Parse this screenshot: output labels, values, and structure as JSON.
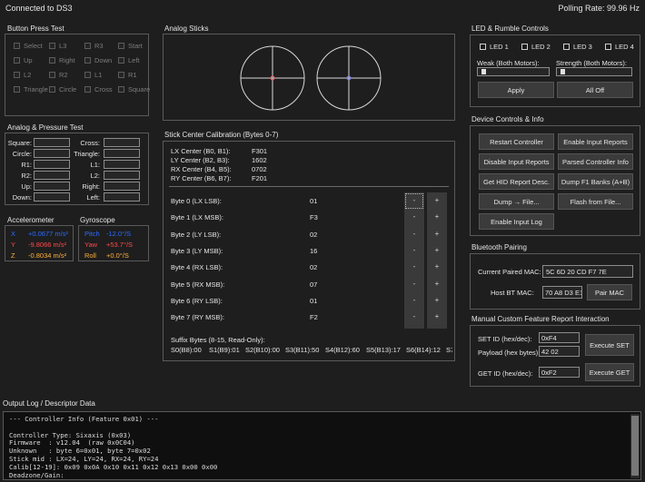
{
  "status": {
    "connection": "Connected to DS3",
    "polling": "Polling Rate: 99.96 Hz"
  },
  "buttons": {
    "title": "Button Press Test",
    "items": [
      "Select",
      "L3",
      "R3",
      "Start",
      "Up",
      "Right",
      "Down",
      "Left",
      "L2",
      "R2",
      "L1",
      "R1",
      "Triangle",
      "Circle",
      "Cross",
      "Square"
    ]
  },
  "analog_pressure": {
    "title": "Analog & Pressure Test",
    "left": [
      "Square:",
      "Circle:",
      "R1:",
      "R2:",
      "Up:",
      "Down:"
    ],
    "right": [
      "Cross:",
      "Triangle:",
      "L1:",
      "L2:",
      "Right:",
      "Left:"
    ]
  },
  "accelerometer": {
    "title": "Accelerometer",
    "rows": [
      {
        "axis": "X",
        "value": "+0.0677 m/s²",
        "color": "#2e6bff"
      },
      {
        "axis": "Y",
        "value": "-9.8066 m/s²",
        "color": "#ff4a4a"
      },
      {
        "axis": "Z",
        "value": "-0.8034 m/s²",
        "color": "#ffb03a"
      }
    ]
  },
  "gyroscope": {
    "title": "Gyroscope",
    "rows": [
      {
        "axis": "Pitch",
        "value": "-12.0°/S",
        "color": "#2e6bff"
      },
      {
        "axis": "Yaw",
        "value": "+53.7°/S",
        "color": "#ff4a4a"
      },
      {
        "axis": "Roll",
        "value": "+0.0°/S",
        "color": "#ffb03a"
      }
    ]
  },
  "analog_sticks": {
    "title": "Analog Sticks",
    "left_dot_color": "#ff6060",
    "right_dot_color": "#7f7fff"
  },
  "calibration": {
    "title": "Stick Center Calibration (Bytes 0-7)",
    "centers": [
      {
        "label": "LX Center (B0, B1):",
        "value": "F301"
      },
      {
        "label": "LY Center (B2, B3):",
        "value": "1602"
      },
      {
        "label": "RX Center (B4, B5):",
        "value": "0702"
      },
      {
        "label": "RY Center (B6, B7):",
        "value": "F201"
      }
    ],
    "bytes": [
      {
        "label": "Byte 0 (LX LSB):",
        "value": "01"
      },
      {
        "label": "Byte 1 (LX MSB):",
        "value": "F3"
      },
      {
        "label": "Byte 2 (LY LSB):",
        "value": "02"
      },
      {
        "label": "Byte 3 (LY MSB):",
        "value": "16"
      },
      {
        "label": "Byte 4 (RX LSB):",
        "value": "02"
      },
      {
        "label": "Byte 5 (RX MSB):",
        "value": "07"
      },
      {
        "label": "Byte 6 (RY LSB):",
        "value": "01"
      },
      {
        "label": "Byte 7 (RY MSB):",
        "value": "F2"
      }
    ],
    "minus": "-",
    "plus": "+",
    "suffix_title": "Suffix Bytes (8-15, Read-Only):",
    "suffix": [
      "S0(B8):00",
      "S1(B9):01",
      "S2(B10):00",
      "S3(B11):50",
      "S4(B12):60",
      "S5(B13):17",
      "S6(B14):12",
      "S7"
    ]
  },
  "led": {
    "title": "LED & Rumble Controls",
    "leds": [
      "LED 1",
      "LED 2",
      "LED 3",
      "LED 4"
    ],
    "weak_label": "Weak (Both Motors):",
    "strength_label": "Strength (Both Motors):",
    "weak_level": 0.05,
    "strength_level": 0.05,
    "apply": "Apply",
    "all_off": "All Off"
  },
  "device": {
    "title": "Device Controls & Info",
    "buttons": [
      [
        "Restart Controller",
        "Enable Input Reports"
      ],
      [
        "Disable Input Reports",
        "Parsed Controller Info"
      ],
      [
        "Get HID Report Desc.",
        "Dump F1 Banks (A+B)"
      ],
      [
        "Dump → File...",
        "Flash from File..."
      ],
      [
        "Enable Input Log"
      ]
    ]
  },
  "bluetooth": {
    "title": "Bluetooth Pairing",
    "current_label": "Current Paired MAC:",
    "current_value": "5C 6D 20 CD F7 7E",
    "host_label": "Host BT MAC:",
    "host_value": "70 A8 D3 E1",
    "pair_button": "Pair MAC"
  },
  "feature": {
    "title": "Manual Custom Feature Report Interaction",
    "set_label": "SET ID (hex/dec):",
    "set_value": "0xF4",
    "payload_label": "Payload (hex bytes):",
    "payload_value": "42 02",
    "execute_set": "Execute SET",
    "get_label": "GET ID (hex/dec):",
    "get_value": "0xF2",
    "execute_get": "Execute GET"
  },
  "log": {
    "title": "Output Log / Descriptor Data",
    "lines": [
      "--- Controller Info (Feature 0x01) ---",
      "",
      "Controller Type: Sixaxis (0x03)",
      "Firmware  : v12.04  (raw 0x0C04)",
      "Unknown   : byte 6=0x01, byte 7=0x02",
      "Stick mid : LX=24, LY=24, RX=24, RY=24",
      "Calib[12-19]: 0x09 0x0A 0x10 0x11 0x12 0x13 0x00 0x00",
      "Deadzone/Gain:"
    ]
  }
}
